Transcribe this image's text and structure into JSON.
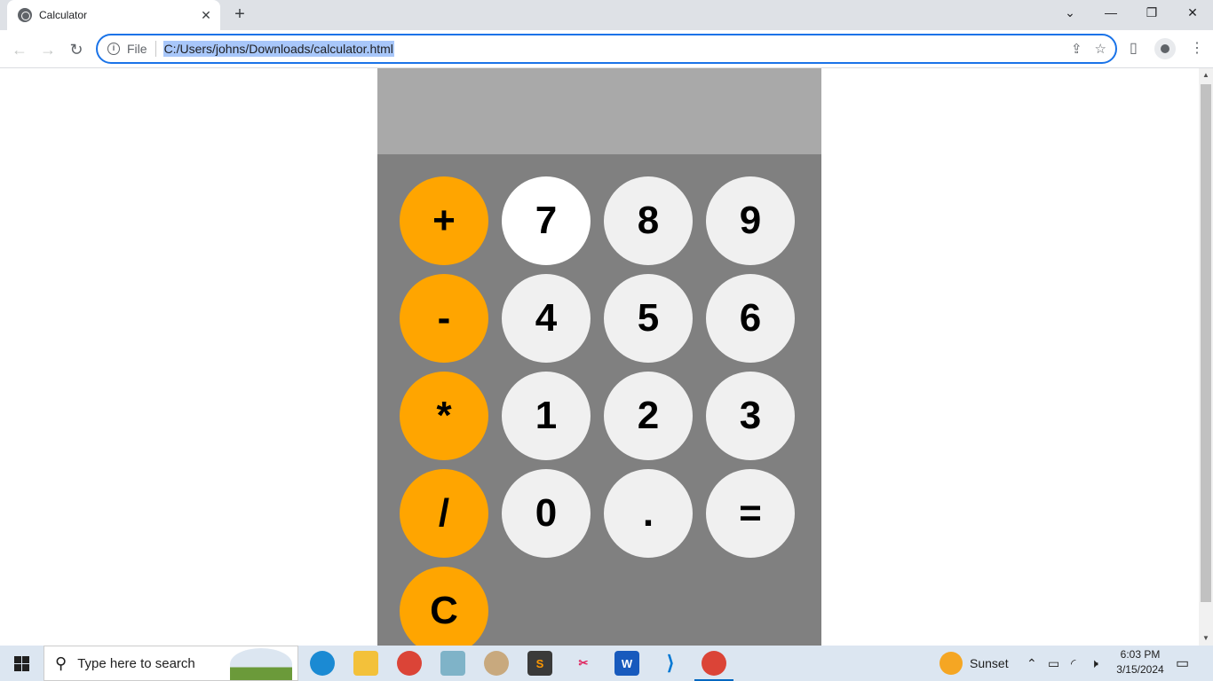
{
  "browser": {
    "tab_title": "Calculator",
    "tab_close": "✕",
    "new_tab": "+",
    "window_controls": {
      "chevron": "⌄",
      "minimize": "—",
      "restore": "❐",
      "close": "✕"
    },
    "nav": {
      "back": "←",
      "forward": "→",
      "reload": "↻"
    },
    "omnibox": {
      "info": "i",
      "scheme_label": "File",
      "url": "C:/Users/johns/Downloads/calculator.html"
    },
    "icons": [
      "share-icon",
      "star-icon",
      "side-panel-icon",
      "profile-icon",
      "menu-icon"
    ]
  },
  "calculator": {
    "display_value": "",
    "keys": [
      {
        "label": "+",
        "type": "operator"
      },
      {
        "label": "7",
        "type": "digit",
        "state": "hover"
      },
      {
        "label": "8",
        "type": "digit"
      },
      {
        "label": "9",
        "type": "digit"
      },
      {
        "label": "-",
        "type": "operator"
      },
      {
        "label": "4",
        "type": "digit"
      },
      {
        "label": "5",
        "type": "digit"
      },
      {
        "label": "6",
        "type": "digit"
      },
      {
        "label": "*",
        "type": "operator"
      },
      {
        "label": "1",
        "type": "digit"
      },
      {
        "label": "2",
        "type": "digit"
      },
      {
        "label": "3",
        "type": "digit"
      },
      {
        "label": "/",
        "type": "operator"
      },
      {
        "label": "0",
        "type": "digit"
      },
      {
        "label": ".",
        "type": "digit"
      },
      {
        "label": "=",
        "type": "equals"
      },
      {
        "label": "C",
        "type": "operator"
      }
    ],
    "colors": {
      "operator": "#ffa500",
      "digit": "#f0f0f0",
      "hover": "#ffffff",
      "panel": "#808080",
      "display": "#a9a9a9"
    }
  },
  "taskbar": {
    "search_placeholder": "Type here to search",
    "apps": [
      "edge-icon",
      "file-explorer-icon",
      "chrome-icon",
      "app-icon",
      "paint-icon",
      "sublime-text-icon",
      "snipping-tool-icon",
      "word-icon",
      "vscode-icon",
      "chrome-icon-active"
    ],
    "weather": "Sunset",
    "time": "6:03 PM",
    "date": "3/15/2024"
  }
}
